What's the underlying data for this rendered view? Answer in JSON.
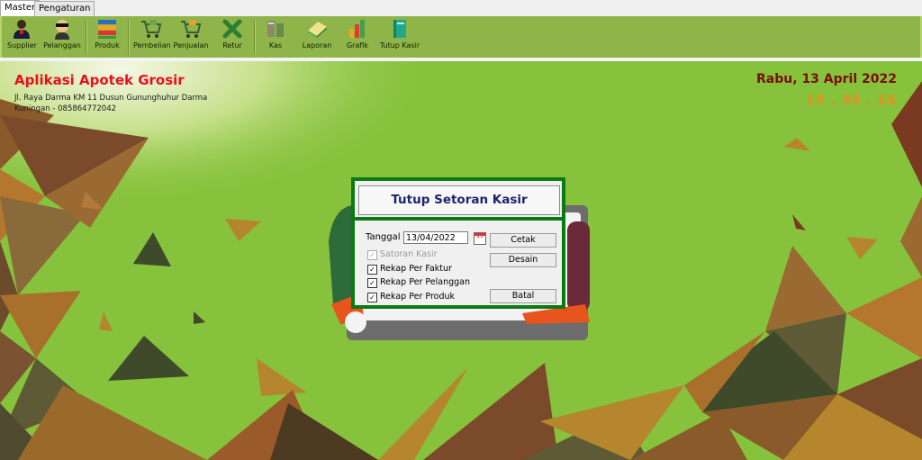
{
  "tabs": [
    {
      "label": "Master",
      "active": true
    },
    {
      "label": "Pengaturan",
      "active": false
    }
  ],
  "ribbon": [
    {
      "label": "Supplier",
      "icon": "supplier-icon"
    },
    {
      "label": "Pelanggan",
      "icon": "pelanggan-icon"
    },
    {
      "label": "Produk",
      "icon": "produk-icon"
    },
    {
      "label": "Pembelian",
      "icon": "pembelian-icon"
    },
    {
      "label": "Penjualan",
      "icon": "penjualan-icon"
    },
    {
      "label": "Retur",
      "icon": "retur-icon"
    },
    {
      "label": "Kas",
      "icon": "kas-icon"
    },
    {
      "label": "Laporan",
      "icon": "laporan-icon"
    },
    {
      "label": "Grafik",
      "icon": "grafik-icon"
    },
    {
      "label": "Tutup Kasir",
      "icon": "tutup-kasir-icon"
    }
  ],
  "app": {
    "title": "Aplikasi Apotek Grosir",
    "address_line1": "Jl. Raya Darma KM 11 Dusun Gununghuhur Darma",
    "address_line2": "Kuningan - 085864772042",
    "date": "Rabu, 13 April 2022",
    "time": "15 . 35 . 15"
  },
  "dialog": {
    "title": "Tutup Setoran Kasir",
    "tanggal_label": "Tanggal",
    "tanggal_value": "13/04/2022",
    "calendar_text": "15",
    "checks": [
      {
        "label": "Satoran Kasir",
        "checked": true,
        "disabled": true
      },
      {
        "label": "Rekap Per Faktur",
        "checked": true,
        "disabled": false
      },
      {
        "label": "Rekap Per Pelanggan",
        "checked": true,
        "disabled": false
      },
      {
        "label": "Rekap Per Produk",
        "checked": true,
        "disabled": false
      }
    ],
    "btn_cetak": "Cetak",
    "btn_desain": "Desain",
    "btn_batal": "Batal"
  },
  "colors": {
    "background": "#86c23b",
    "title_red": "#e8111b",
    "date_maroon": "#7a0d0d",
    "clock_orange": "#f28b1e",
    "dialog_border": "#0a7a12"
  }
}
